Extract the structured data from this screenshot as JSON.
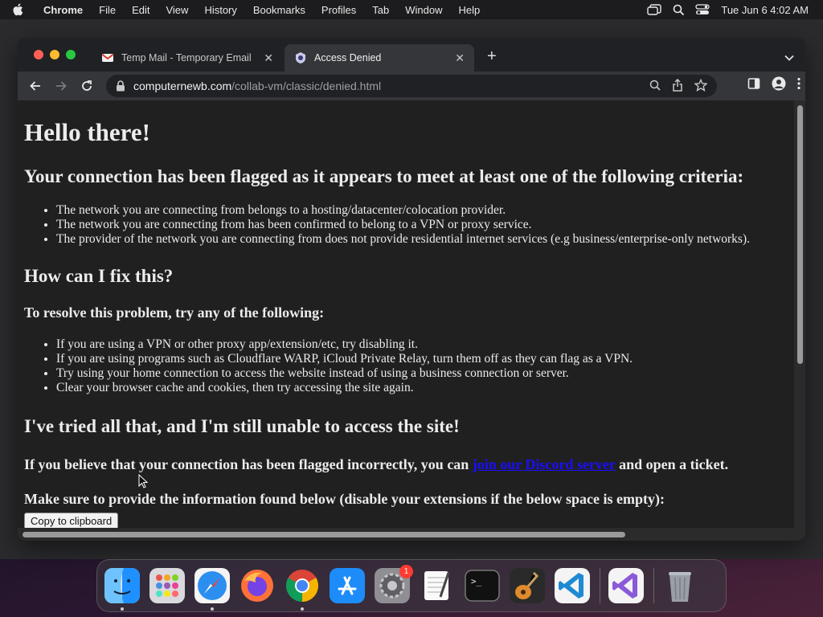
{
  "menubar": {
    "app": "Chrome",
    "items": [
      "File",
      "Edit",
      "View",
      "History",
      "Bookmarks",
      "Profiles",
      "Tab",
      "Window",
      "Help"
    ],
    "clock": "Tue Jun 6  4:02 AM"
  },
  "tabs": [
    {
      "title": "Temp Mail - Temporary Email",
      "icon": "gmail-icon"
    },
    {
      "title": "Access Denied",
      "icon": "computernewb-icon"
    }
  ],
  "address": {
    "host": "computernewb.com",
    "path": "/collab-vm/classic/denied.html"
  },
  "page": {
    "heading": "Hello there!",
    "flag_heading": "Your connection has been flagged as it appears to meet at least one of the following criteria:",
    "criteria": [
      "The network you are connecting from belongs to a hosting/datacenter/colocation provider.",
      "The network you are connecting from has been confirmed to belong to a VPN or proxy service.",
      "The provider of the network you are connecting from does not provide residential internet services (e.g business/enterprise-only networks)."
    ],
    "fix_heading": "How can I fix this?",
    "resolve_heading": "To resolve this problem, try any of the following:",
    "fixes": [
      "If you are using a VPN or other proxy app/extension/etc, try disabling it.",
      "If you are using programs such as Cloudflare WARP, iCloud Private Relay, turn them off as they can flag as a VPN.",
      "Try using your home connection to access the website instead of using a business connection or server.",
      "Clear your browser cache and cookies, then try accessing the site again."
    ],
    "still_heading": "I've tried all that, and I'm still unable to access the site!",
    "ticket_before": "If you believe that your connection has been flagged incorrectly, you can ",
    "ticket_link": "join our Discord server",
    "ticket_after": " and open a ticket.",
    "info_text": "Make sure to provide the information found below (disable your extensions if the below space is empty):",
    "copy_button": "Copy to clipboard"
  },
  "dock": {
    "apps": [
      "finder-icon",
      "launchpad-icon",
      "safari-icon",
      "firefox-icon",
      "chrome-icon",
      "app-store-icon",
      "system-settings-icon",
      "textedit-icon",
      "terminal-icon",
      "garageband-icon",
      "vscode-icon",
      "visual-studio-icon",
      "trash-icon"
    ],
    "settings_badge": "1"
  }
}
